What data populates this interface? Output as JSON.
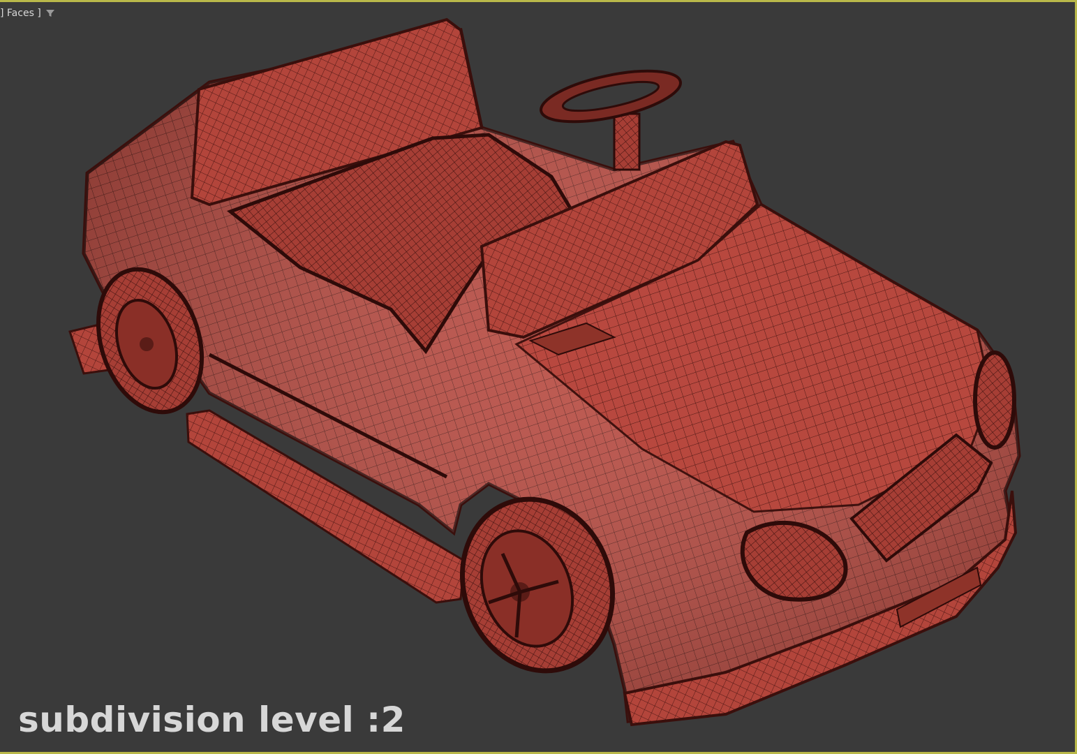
{
  "viewport": {
    "label": "] Faces ]",
    "filter_icon": "filter-funnel-icon",
    "border_color": "#b9b84a",
    "background_color": "#3a3a3a"
  },
  "model": {
    "description_icon": "car-wireframe-model",
    "surface_color": "#b8483e",
    "wire_color": "#3a0f0c"
  },
  "caption": {
    "text": "subdivision level :2"
  }
}
